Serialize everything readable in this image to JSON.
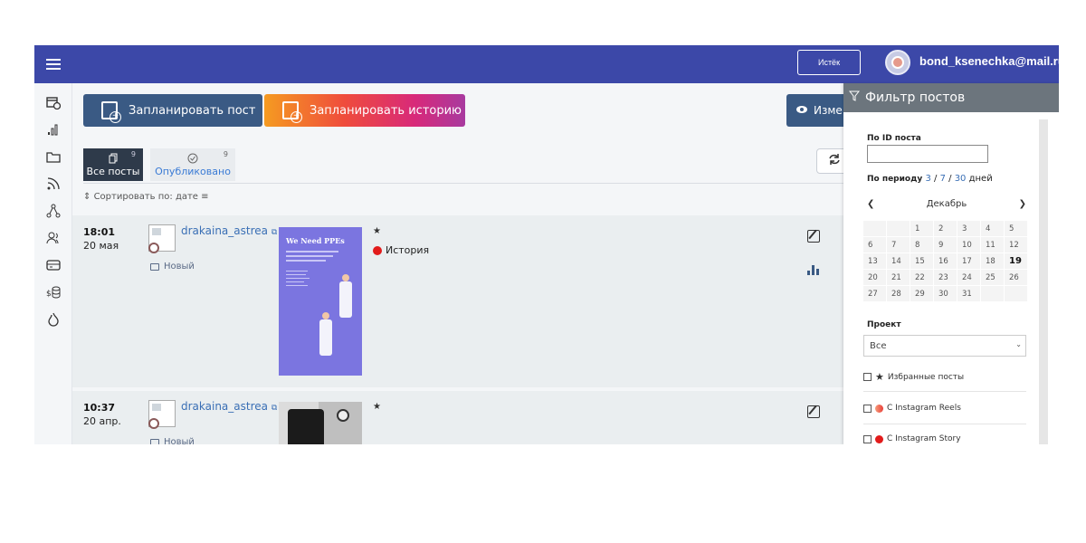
{
  "topbar": {
    "expire_label": "Истёк",
    "user_email": "bond_ksenechka@mail.ru"
  },
  "rail": {
    "icons": [
      "calendar-clock-icon",
      "bar-chart-icon",
      "folder-icon",
      "rss-icon",
      "network-icon",
      "users-icon",
      "card-icon",
      "money-icon",
      "fire-icon"
    ]
  },
  "toolbar": {
    "plan_post_label": "Запланировать пост",
    "plan_story_label": "Запланировать историю",
    "change_label": "Изме"
  },
  "tabs": [
    {
      "label": "Все посты",
      "count": "9"
    },
    {
      "label": "Опубликовано",
      "count": "9"
    }
  ],
  "sort": {
    "label": "Сортировать по: дате"
  },
  "posts": [
    {
      "time": "18:01",
      "date": "20 мая",
      "account": "drakaina_astrea",
      "status": "Новый",
      "preview_title": "We Need PPEs",
      "type_label": "История",
      "type_color": "#e21b1b"
    },
    {
      "time": "10:37",
      "date": "20 апр.",
      "account": "drakaina_astrea",
      "status": "Новый"
    }
  ],
  "filter": {
    "title": "Фильтр постов",
    "id_label": "По ID поста",
    "period_label": "По периоду",
    "period_3": "3",
    "period_7": "7",
    "period_30": "30",
    "period_unit": "дней",
    "sep": "/",
    "month": "Декабрь",
    "calendar_days": [
      "",
      "",
      "1",
      "2",
      "3",
      "4",
      "5",
      "6",
      "7",
      "8",
      "9",
      "10",
      "11",
      "12",
      "13",
      "14",
      "15",
      "16",
      "17",
      "18",
      "19",
      "20",
      "21",
      "22",
      "23",
      "24",
      "25",
      "26",
      "27",
      "28",
      "29",
      "30",
      "31",
      "",
      ""
    ],
    "today": "19",
    "project_label": "Проект",
    "project_value": "Все",
    "checks": [
      "Избранные посты",
      "С Instagram Reels",
      "С Instagram Story"
    ]
  },
  "colors": {
    "topbar": "#3c48a8",
    "primary_button": "#3a5a84",
    "link": "#3a6fb5"
  }
}
